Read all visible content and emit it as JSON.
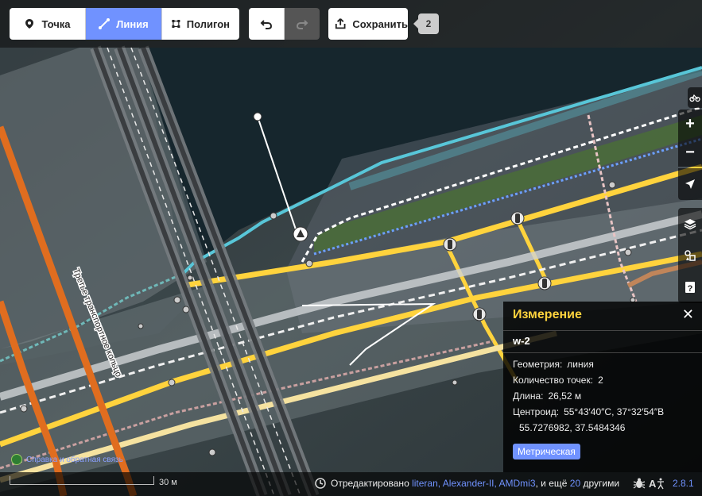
{
  "toolbar": {
    "point_label": "Точка",
    "line_label": "Линия",
    "polygon_label": "Полигон",
    "save_label": "Сохранить",
    "edit_count": "2"
  },
  "map": {
    "street_label": "Третье транспортное кольцо",
    "feedback_text": "Справка и обратная связь"
  },
  "measurement": {
    "title": "Измерение",
    "feature_id": "w-2",
    "geometry_label": "Геометрия:",
    "geometry_value": "линия",
    "points_label": "Количество точек:",
    "points_value": "2",
    "length_label": "Длина:",
    "length_value": "26,52 м",
    "centroid_label": "Центроид:",
    "centroid_dms": "55°43′40″С, 37°32′54″В",
    "centroid_decimal": "55.7276982, 37.5484346",
    "units_button": "Метрическая"
  },
  "footer": {
    "scale_label": "30 м",
    "edited_prefix": "Отредактировано",
    "editors": "literan, Alexander-II, AMDmi3",
    "and_more_prefix": ", и ещё",
    "more_count": "20",
    "others_suffix": "другими",
    "version": "2.8.1"
  },
  "colors": {
    "accent": "#7092ff",
    "panel_title": "#ffd33d",
    "primary_road": "#ffd33d",
    "trunk": "#e06d1f",
    "water_edge": "#58c6d8"
  }
}
